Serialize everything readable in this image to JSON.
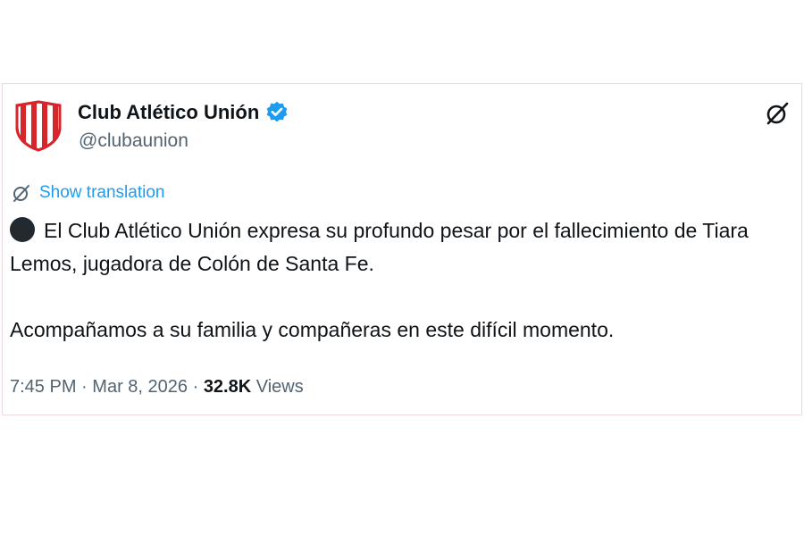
{
  "tweet": {
    "author_name": "Club Atlético Unión",
    "handle": "@clubaunion",
    "show_translation": "Show translation",
    "paragraph1": "El Club Atlético Unión expresa su profundo pesar por el fallecimiento de Tiara Lemos, jugadora de Colón de Santa Fe.",
    "paragraph2": "Acompañamos a su familia y compañeras en este difícil momento.",
    "time": "7:45 PM",
    "date": "Mar 8, 2026",
    "views_count": "32.8K",
    "views_label": "Views",
    "separator": "·"
  },
  "colors": {
    "club_red": "#d7262b",
    "verified_blue": "#1d9bf0",
    "text_primary": "#0f1419",
    "text_secondary": "#536471",
    "card_border": "#f0d9e0"
  },
  "icons": {
    "avatar": "club-shield-logo",
    "verified": "verified-badge-icon",
    "grok": "grok-icon",
    "translate": "translate-icon",
    "emoji": "black-circle-emoji"
  }
}
